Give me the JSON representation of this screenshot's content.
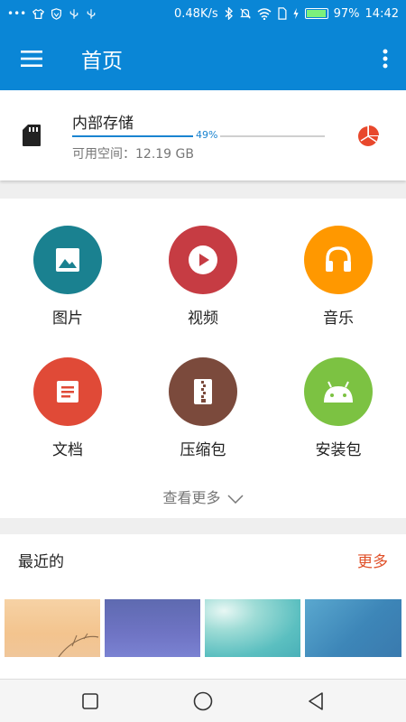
{
  "status_bar": {
    "speed": "0.48K/s",
    "battery": "97%",
    "time": "14:42",
    "left_icons": [
      "more-dots-icon",
      "shirt-icon",
      "shield-icon",
      "usb-icon",
      "usb-icon"
    ],
    "right_icons": [
      "bluetooth-icon",
      "mute-icon",
      "wifi-icon",
      "sim-icon",
      "charging-icon",
      "battery-icon"
    ]
  },
  "app_bar": {
    "title": "首页",
    "menu_icon": "hamburger-menu-icon",
    "more_icon": "vertical-dots-icon",
    "color": "#0a86d6"
  },
  "storage": {
    "title": "内部存储",
    "used_percent_label": "49%",
    "used_fraction": 0.49,
    "free_space": "可用空间：12.19 GB",
    "icon": "sd-card-icon",
    "chart_icon": "pie-chart-icon"
  },
  "categories": [
    {
      "label": "图片",
      "icon": "image-icon",
      "color": "#1a8190"
    },
    {
      "label": "视频",
      "icon": "play-icon",
      "color": "#c63c43"
    },
    {
      "label": "音乐",
      "icon": "headphones-icon",
      "color": "#ff9800"
    },
    {
      "label": "文档",
      "icon": "document-icon",
      "color": "#e04a37"
    },
    {
      "label": "压缩包",
      "icon": "zip-icon",
      "color": "#7b4a3c"
    },
    {
      "label": "安装包",
      "icon": "android-icon",
      "color": "#7cc242"
    }
  ],
  "see_more": "查看更多",
  "recent": {
    "title": "最近的",
    "more": "更多",
    "thumbnails": [
      {
        "name": "thumbnail-warm-sunset"
      },
      {
        "name": "thumbnail-purple-gradient"
      },
      {
        "name": "thumbnail-teal-sky"
      },
      {
        "name": "thumbnail-blue-gradient"
      }
    ]
  },
  "nav": [
    "recent-apps-icon",
    "home-icon",
    "back-icon"
  ]
}
